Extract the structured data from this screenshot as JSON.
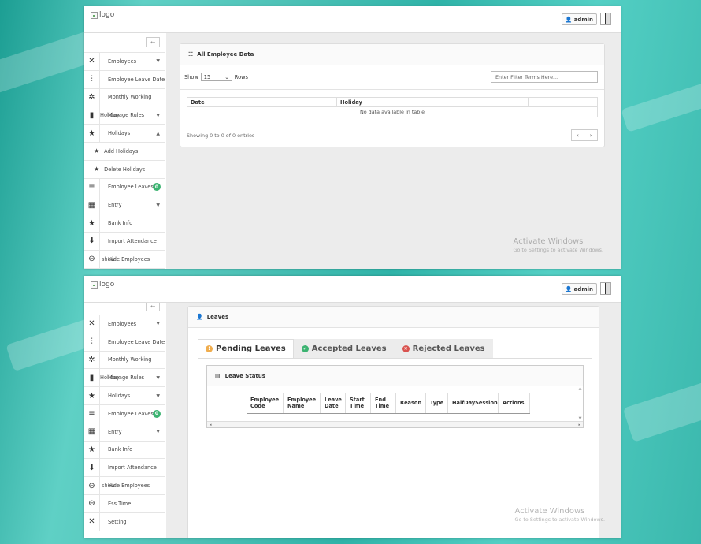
{
  "logo_alt": "logo",
  "admin_label": "admin",
  "watermark": {
    "title": "Activate Windows",
    "subtitle": "Go to Settings to activate Windows."
  },
  "shot1": {
    "sidebar": {
      "items": [
        {
          "label": "Employees",
          "icon": "tools-icon",
          "glyph": "✕"
        },
        {
          "label": "Employee Leave Date",
          "icon": "sliders-icon",
          "glyph": "⫶"
        },
        {
          "label": "Monthly Working",
          "icon": "cog-icon",
          "glyph": "✲"
        },
        {
          "label": "Manage Rules",
          "overlap": "Holiday",
          "icon": "bookmark-icon",
          "glyph": "▮"
        },
        {
          "label": "Holidays",
          "icon": "star-icon",
          "glyph": "★"
        }
      ],
      "sub_items": [
        "Add Holidays",
        "Delete Holidays"
      ],
      "items_after": [
        {
          "label": "Employee Leaves",
          "badge": "0",
          "icon": "list-icon",
          "glyph": "≡"
        },
        {
          "label": "Entry",
          "icon": "calendar-icon",
          "glyph": "▦"
        },
        {
          "label": "Bank Info",
          "icon": "star-icon",
          "glyph": "★"
        },
        {
          "label": "Import Attendance",
          "icon": "download-icon",
          "glyph": "⬇"
        },
        {
          "label": "Hide Employees",
          "overlap": "show",
          "icon": "minus-circle-icon",
          "glyph": "⊖"
        }
      ]
    },
    "panel": {
      "title": "All Employee Data",
      "show_label": "Show",
      "rows_value": "15",
      "rows_label": "Rows",
      "filter_placeholder": "Enter Filter Terms Here...",
      "columns": [
        "Date",
        "Holiday",
        ""
      ],
      "empty_text": "No data available in table",
      "showing_text": "Showing 0 to 0 of 0 entries",
      "pager_prev": "‹",
      "pager_next": "›"
    }
  },
  "shot2": {
    "sidebar": {
      "items": [
        {
          "label": "Employees",
          "icon": "tools-icon",
          "glyph": "✕"
        },
        {
          "label": "Employee Leave Date",
          "icon": "sliders-icon",
          "glyph": "⫶"
        },
        {
          "label": "Monthly Working",
          "icon": "cog-icon",
          "glyph": "✲"
        },
        {
          "label": "Manage Rules",
          "overlap": "Holiday",
          "icon": "bookmark-icon",
          "glyph": "▮"
        },
        {
          "label": "Holidays",
          "icon": "star-icon",
          "glyph": "★"
        },
        {
          "label": "Employee Leaves",
          "badge": "0",
          "icon": "list-icon",
          "glyph": "≡"
        },
        {
          "label": "Entry",
          "icon": "calendar-icon",
          "glyph": "▦"
        },
        {
          "label": "Bank Info",
          "icon": "star-icon",
          "glyph": "★"
        },
        {
          "label": "Import Attendance",
          "icon": "download-icon",
          "glyph": "⬇"
        },
        {
          "label": "Hide Employees",
          "overlap": "show",
          "icon": "minus-circle-icon",
          "glyph": "⊖"
        },
        {
          "label": "Ess Time",
          "icon": "minus-circle-icon",
          "glyph": "⊖"
        },
        {
          "label": "Setting",
          "icon": "tools-icon",
          "glyph": "✕"
        }
      ]
    },
    "panel": {
      "title": "Leaves",
      "tabs": [
        {
          "label": "Pending Leaves",
          "color": "#f0ad4e",
          "glyph": "!"
        },
        {
          "label": "Accepted Leaves",
          "color": "#3cb371",
          "glyph": "✓"
        },
        {
          "label": "Rejected Leaves",
          "color": "#d9534f",
          "glyph": "✕"
        }
      ],
      "inner_title": "Leave Status",
      "columns": [
        "Employee Code",
        "Employee Name",
        "Leave Date",
        "Start Time",
        "End Time",
        "Reason",
        "Type",
        "HalfDaySession",
        "Actions"
      ]
    }
  }
}
